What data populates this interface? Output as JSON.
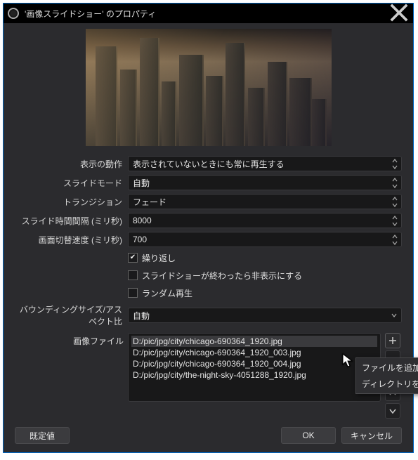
{
  "window": {
    "title": "'画像スライドショー' のプロパティ"
  },
  "labels": {
    "visibility": "表示の動作",
    "slide_mode": "スライドモード",
    "transition": "トランジション",
    "slide_interval": "スライド時間間隔 (ミリ秒)",
    "switch_speed": "画面切替速度 (ミリ秒)",
    "bounding": "バウンディングサイズ/アスペクト比",
    "image_files": "画像ファイル"
  },
  "fields": {
    "visibility": "表示されていないときにも常に再生する",
    "slide_mode": "自動",
    "transition": "フェード",
    "slide_interval": "8000",
    "switch_speed": "700",
    "bounding": "自動"
  },
  "checkboxes": {
    "loop": {
      "label": "繰り返し",
      "checked": true
    },
    "hide_after_end": {
      "label": "スライドショーが終わったら非表示にする",
      "checked": false
    },
    "random": {
      "label": "ランダム再生",
      "checked": false
    }
  },
  "file_list": [
    "D:/pic/jpg/city/chicago-690364_1920.jpg",
    "D:/pic/jpg/city/chicago-690364_1920_003.jpg",
    "D:/pic/jpg/city/chicago-690364_1920_004.jpg",
    "D:/pic/jpg/city/the-night-sky-4051288_1920.jpg"
  ],
  "context_menu": {
    "add_file": "ファイルを追加",
    "add_dir": "ディレクトリを追加"
  },
  "buttons": {
    "defaults": "既定値",
    "ok": "OK",
    "cancel": "キャンセル"
  }
}
